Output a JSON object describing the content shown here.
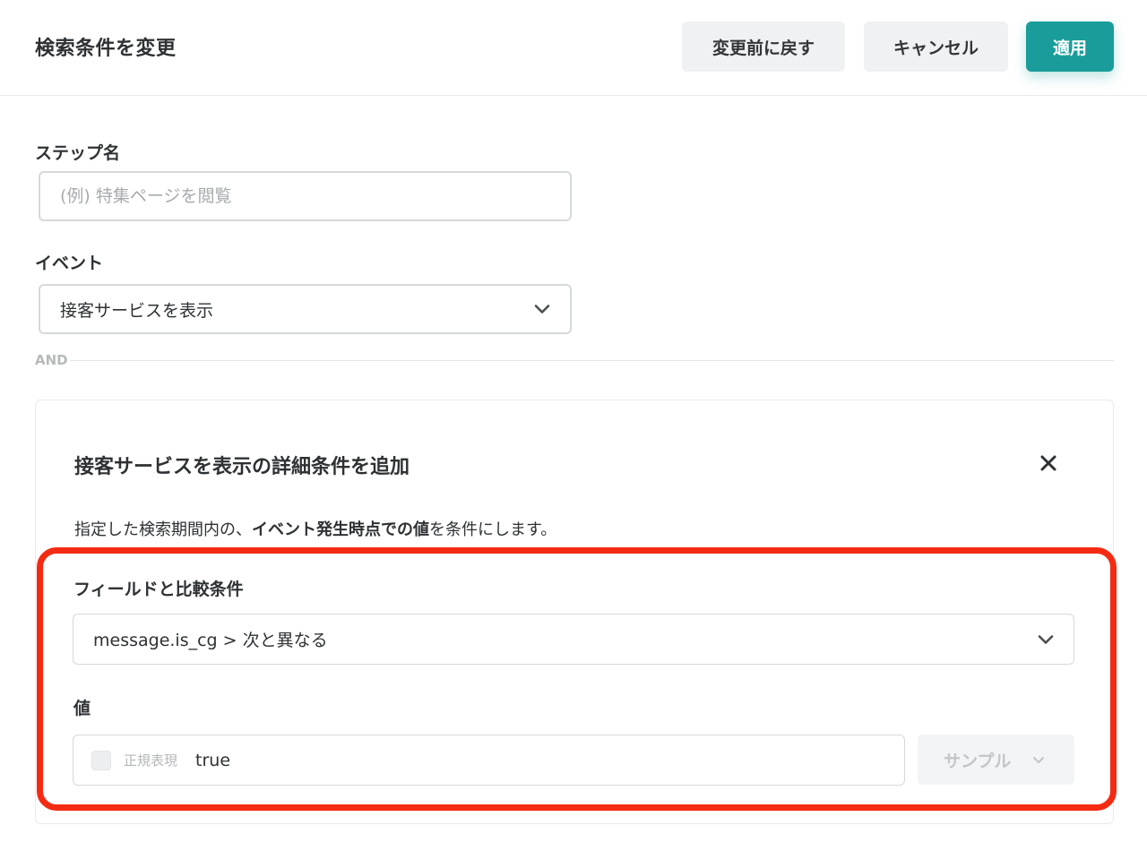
{
  "header": {
    "title": "検索条件を変更",
    "revert_label": "変更前に戻す",
    "cancel_label": "キャンセル",
    "apply_label": "適用"
  },
  "step_name": {
    "label": "ステップ名",
    "placeholder": "(例) 特集ページを閲覧",
    "value": ""
  },
  "event": {
    "label": "イベント",
    "selected": "接客サービスを表示"
  },
  "and_label": "AND",
  "detail": {
    "title": "接客サービスを表示の詳細条件を追加",
    "description_pre": "指定した検索期間内の、",
    "description_bold": "イベント発生時点での値",
    "description_post": "を条件にします。",
    "field_label": "フィールドと比較条件",
    "field_selected": "message.is_cg > 次と異なる",
    "value_label": "値",
    "regex_label": "正規表現",
    "regex_checked": false,
    "value": "true",
    "sample_label": "サンプル"
  },
  "colors": {
    "accent": "#1a9d9a",
    "highlight": "#f42b13"
  }
}
